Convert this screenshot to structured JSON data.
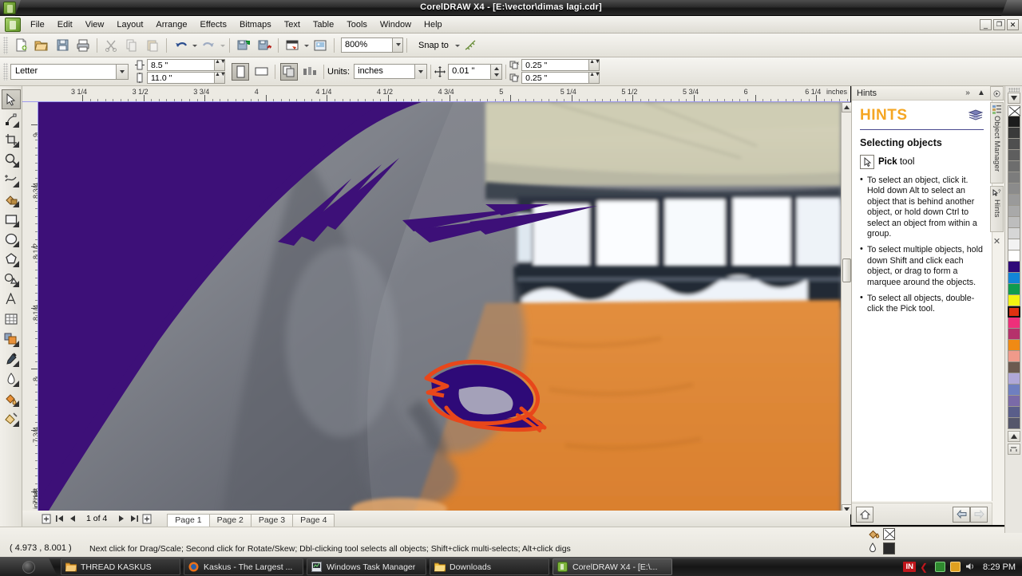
{
  "window": {
    "title": "CorelDRAW X4 - [E:\\vector\\dimas lagi.cdr]",
    "minimize": "_",
    "maximize": "❐",
    "close": "✕"
  },
  "menubar": {
    "items": [
      {
        "label": "File"
      },
      {
        "label": "Edit"
      },
      {
        "label": "View"
      },
      {
        "label": "Layout"
      },
      {
        "label": "Arrange"
      },
      {
        "label": "Effects"
      },
      {
        "label": "Bitmaps"
      },
      {
        "label": "Text"
      },
      {
        "label": "Table"
      },
      {
        "label": "Tools"
      },
      {
        "label": "Window"
      },
      {
        "label": "Help"
      }
    ]
  },
  "standard_toolbar": {
    "buttons": [
      {
        "name": "new-document",
        "icon": "new-icon"
      },
      {
        "name": "open-document",
        "icon": "folder-open-icon"
      },
      {
        "name": "save-document",
        "icon": "save-icon"
      },
      {
        "name": "print",
        "icon": "printer-icon"
      },
      {
        "name": "cut",
        "icon": "scissors-icon"
      },
      {
        "name": "copy",
        "icon": "copy-icon"
      },
      {
        "name": "paste",
        "icon": "paste-icon"
      },
      {
        "name": "undo",
        "icon": "undo-icon"
      },
      {
        "name": "redo",
        "icon": "redo-icon"
      },
      {
        "name": "import",
        "icon": "import-icon"
      },
      {
        "name": "export",
        "icon": "export-icon"
      },
      {
        "name": "application-launcher",
        "icon": "launcher-icon"
      },
      {
        "name": "corel-online",
        "icon": "online-icon"
      }
    ],
    "zoom_level": "800%",
    "snap_to_label": "Snap to",
    "snap_icon": "snap-icon"
  },
  "property_bar": {
    "paper_type": "Letter",
    "page_width": "8.5 \"",
    "page_height": "11.0 \"",
    "orientation_portrait": "portrait-icon",
    "orientation_landscape": "landscape-icon",
    "all_pages_icon": "all-pages-icon",
    "current_page_icon": "current-page-icon",
    "units_label": "Units:",
    "units_value": "inches",
    "nudge_value": "0.01 \"",
    "duplicate_x": "0.25 \"",
    "duplicate_y": "0.25 \""
  },
  "toolbox": {
    "tools": [
      {
        "name": "pick-tool",
        "selected": true
      },
      {
        "name": "shape-tool",
        "selected": false
      },
      {
        "name": "crop-tool",
        "selected": false
      },
      {
        "name": "zoom-tool",
        "selected": false
      },
      {
        "name": "freehand-tool",
        "selected": false
      },
      {
        "name": "smart-fill-tool",
        "selected": false
      },
      {
        "name": "rectangle-tool",
        "selected": false
      },
      {
        "name": "ellipse-tool",
        "selected": false
      },
      {
        "name": "polygon-tool",
        "selected": false
      },
      {
        "name": "basic-shapes-tool",
        "selected": false
      },
      {
        "name": "text-tool",
        "selected": false
      },
      {
        "name": "table-tool",
        "selected": false
      },
      {
        "name": "blend-tool",
        "selected": false
      },
      {
        "name": "eyedropper-tool",
        "selected": false
      },
      {
        "name": "outline-tool",
        "selected": false
      },
      {
        "name": "fill-tool",
        "selected": false
      },
      {
        "name": "interactive-fill-tool",
        "selected": false
      }
    ]
  },
  "rulers": {
    "horizontal_unit": "inches",
    "vertical_unit": "inches",
    "horizontal_labels": [
      "3 1/4",
      "3 1/2",
      "3 3/4",
      "4",
      "4 1/4",
      "4 1/2",
      "4 3/4",
      "5",
      "5 1/4",
      "5 1/2",
      "5 3/4",
      "6",
      "6 1/4"
    ],
    "vertical_labels": [
      "9",
      "8 3/4",
      "8 1/2",
      "8 1/4",
      "8",
      "7 3/4",
      "7 1/2"
    ]
  },
  "page_navigator": {
    "first_icon": "first-page-icon",
    "prev_icon": "prev-page-icon",
    "next_icon": "next-page-icon",
    "last_icon": "last-page-icon",
    "add_page_before": "add-page-icon",
    "add_page_after": "add-page-icon",
    "page_count": "1 of 4",
    "tabs": [
      {
        "label": "Page 1",
        "active": true
      },
      {
        "label": "Page 2",
        "active": false
      },
      {
        "label": "Page 3",
        "active": false
      },
      {
        "label": "Page 4",
        "active": false
      }
    ]
  },
  "status_bar": {
    "coordinates": "( 4.973 , 8.001 )",
    "hint": "Next click for Drag/Scale; Second click for Rotate/Skew; Dbl-clicking tool selects all objects; Shift+click multi-selects; Alt+click digs",
    "fill_icon": "fill-bucket-icon",
    "outline_icon": "outline-pen-icon",
    "fill_value": "none",
    "outline_color": "#2b2b2b"
  },
  "docker": {
    "title": "Hints",
    "collapse_icon": "chevron-double-right-icon",
    "minimize_icon": "chevron-up-icon",
    "close_icon": "close-icon",
    "heading": "HINTS",
    "heading_color": "#f5a623",
    "book_icon": "book-icon",
    "subheading": "Selecting objects",
    "pick_tool_icon": "pick-tool-icon",
    "pick_tool_label_bold": "Pick",
    "pick_tool_label_rest": " tool",
    "bullets": [
      "To select an object, click it. Hold down Alt to select an object that is behind another object, or hold down Ctrl to select an object from within a group.",
      "To select multiple objects, hold down Shift and click each object, or drag to form a marquee around the objects.",
      "To select all objects, double-click the Pick tool."
    ],
    "home_icon": "home-icon",
    "back_icon": "arrow-left-icon",
    "forward_icon": "arrow-right-icon",
    "tabs": [
      {
        "label": "Object Manager",
        "icon": "object-manager-icon"
      },
      {
        "label": "Hints",
        "icon": "hints-icon"
      }
    ],
    "tab_close_icon": "close-icon",
    "pin_icon": "pin-icon"
  },
  "palette": {
    "scroll_up_icon": "scroll-up-icon",
    "scroll_down_icon": "scroll-down-icon",
    "expand_icon": "expand-palette-icon",
    "colors": [
      "none",
      "#1c1c1c",
      "#3a3a3a",
      "#4f4f4f",
      "#5e5e5e",
      "#6d6d6d",
      "#7c7c7c",
      "#8b8b8b",
      "#9a9a9a",
      "#a9a9a9",
      "#bdbdbd",
      "#d6d6d6",
      "#f2f2f2",
      "#ffffff",
      "#2e0a78",
      "#1285d8",
      "#0f9c4f",
      "#f3f312",
      "#e03110",
      "#ef2f7a",
      "#b5316b",
      "#f08a14",
      "#f09a8a",
      "#6b5a50",
      "#b0a8d8",
      "#6f7fc0",
      "#7a6aa8",
      "#5a5e8a",
      "#55566b"
    ],
    "selected_index": 18
  },
  "canvas": {
    "artwork_name": "portrait-vector-trace",
    "background_photo": "person-portrait-with-windows",
    "purple_fill": "#3d1078",
    "eye_outline": "#e8471a",
    "eye_fill": "#2e0a78",
    "wall_color": "#e08a3c"
  },
  "taskbar": {
    "start_label": "start-orb",
    "items": [
      {
        "label": "THREAD KASKUS",
        "icon": "folder-icon",
        "icon_color": "#e8a33d",
        "active": false
      },
      {
        "label": "Kaskus - The Largest ...",
        "icon": "firefox-icon",
        "icon_color": "#e8701a",
        "active": false
      },
      {
        "label": "Windows Task Manager",
        "icon": "taskmgr-icon",
        "icon_color": "#c8ccd4",
        "active": false
      },
      {
        "label": "Downloads",
        "icon": "folder-icon",
        "icon_color": "#f0c040",
        "active": false
      },
      {
        "label": "CorelDRAW X4 - [E:\\...",
        "icon": "coreldraw-icon",
        "icon_color": "#7db43c",
        "active": true
      }
    ],
    "tray": {
      "language": "IN",
      "icons": [
        "green-square-icon",
        "orange-square-icon",
        "sound-icon"
      ],
      "clock": "8:29 PM"
    }
  }
}
